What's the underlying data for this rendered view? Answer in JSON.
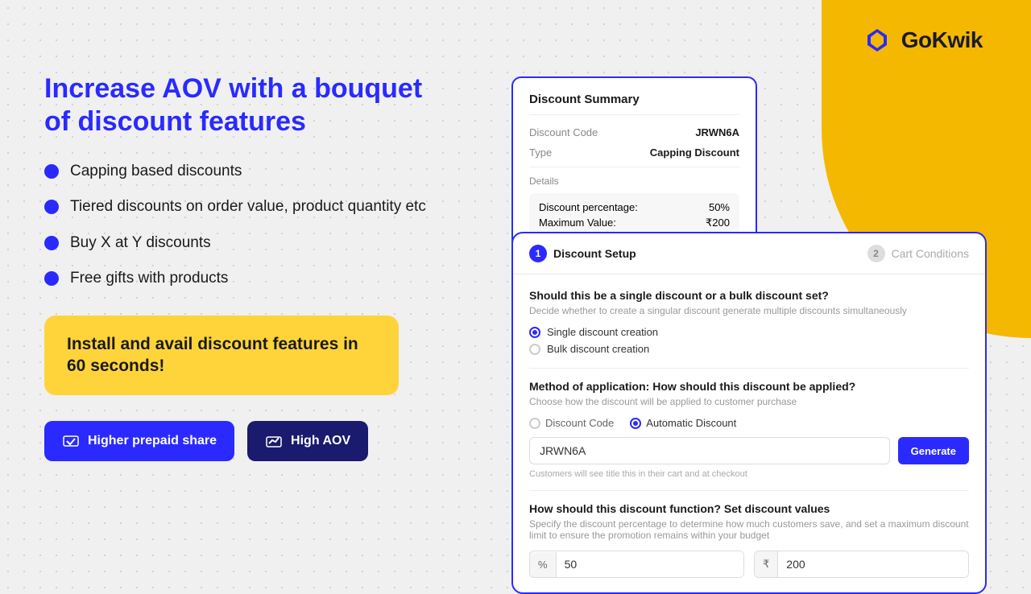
{
  "logo": {
    "text": "GoKwik"
  },
  "hero": {
    "heading_line1": "Increase AOV with a bouquet",
    "heading_line2": "of discount features"
  },
  "features": [
    {
      "text": "Capping based discounts"
    },
    {
      "text": "Tiered discounts on order value, product quantity etc"
    },
    {
      "text": "Buy X at Y discounts"
    },
    {
      "text": "Free gifts with products"
    }
  ],
  "cta_box": {
    "text": "Install and avail discount features in 60 seconds!"
  },
  "buttons": {
    "prepaid": "Higher prepaid share",
    "aov": "High AOV"
  },
  "discount_summary": {
    "title": "Discount Summary",
    "code_label": "Discount Code",
    "code_value": "JRWN6A",
    "type_label": "Type",
    "type_value": "Capping Discount",
    "details_label": "Details",
    "details": [
      {
        "label": "Discount percentage:",
        "value": "50%"
      },
      {
        "label": "Maximum Value:",
        "value": "₹200"
      }
    ]
  },
  "discount_setup": {
    "step1_label": "Discount Setup",
    "step2_number": "2",
    "step2_label": "Cart Conditions",
    "q1_label": "Should this be a single discount or a bulk discount set?",
    "q1_desc": "Decide whether to create a singular discount generate multiple discounts simultaneously",
    "radio_options": [
      {
        "label": "Single discount creation",
        "selected": true
      },
      {
        "label": "Bulk discount creation",
        "selected": false
      }
    ],
    "q2_label": "Method of application: How should this discount be applied?",
    "q2_desc": "Choose how the discount will be applied to customer purchase",
    "method_options": [
      {
        "label": "Discount Code",
        "selected": false
      },
      {
        "label": "Automatic Discount",
        "selected": true
      }
    ],
    "code_value": "JRWN6A",
    "generate_btn": "Generate",
    "code_hint": "Customers will see title this in their cart and at checkout",
    "q3_label": "How should this discount function? Set discount values",
    "q3_desc": "Specify the discount percentage to determine how much customers save, and set a maximum discount limit to ensure the promotion remains within your budget",
    "percent_label": "%",
    "percent_value": "50",
    "rupee_label": "₹",
    "rupee_value": "200"
  }
}
